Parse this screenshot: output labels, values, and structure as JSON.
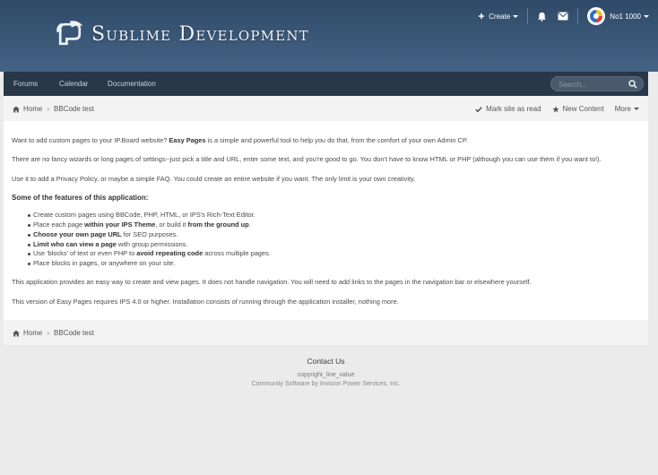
{
  "header": {
    "logo_text": "Sublime Development",
    "create_label": "Create",
    "user_name": "No1 1000"
  },
  "nav": {
    "items": [
      "Forums",
      "Calendar",
      "Documentation"
    ],
    "search_placeholder": "Search..."
  },
  "breadcrumb": {
    "home": "Home",
    "current": "BBCode test"
  },
  "actions": {
    "mark_read": "Mark site as read",
    "new_content": "New Content",
    "more": "More"
  },
  "content": {
    "p1_pre": "Want to add custom pages to your IP.Board website? ",
    "p1_bold": "Easy Pages",
    "p1_post": " is a simple and powerful tool to help you do that, from the comfort of your own Admin CP.",
    "p2": "There are no fancy wizards or long pages of settings--just pick a title and URL, enter some text, and you're good to go. You don't have to know HTML or PHP (although you can use them if you want to!).",
    "p3": "Use it to add a Privacy Policy, or maybe a simple FAQ. You could create an entire website if you want. The only limit is your own creativity.",
    "features_heading": "Some of the features of this application:",
    "f1": "Create custom pages using BBCode, PHP, HTML, or IPS's Rich-Text Editor.",
    "f2_a": "Place each page ",
    "f2_b": "within your IPS Theme",
    "f2_c": ", or build it ",
    "f2_d": "from the ground up",
    "f2_e": ".",
    "f3_a": "Choose your own page URL",
    "f3_b": " for SEO purposes.",
    "f4_a": "Limit who can view a page",
    "f4_b": " with group permissions.",
    "f5_a": "Use 'blocks' of text or even PHP to ",
    "f5_b": "avoid repeating code",
    "f5_c": " across multiple pages.",
    "f6": "Place blocks in pages, or anywhere on your site.",
    "p4": "This application provides an easy way to create and view pages. It does not handle navigation. You will need to add links to the pages in the navigation bar or elsewhere yourself.",
    "p5": "This version of Easy Pages requires IPS 4.0 or higher. Installation consists of running through the application installer, nothing more."
  },
  "footer": {
    "contact": "Contact Us",
    "copyright": "copyright_line_value",
    "powered": "Community Software by Invision Power Services, Inc."
  }
}
